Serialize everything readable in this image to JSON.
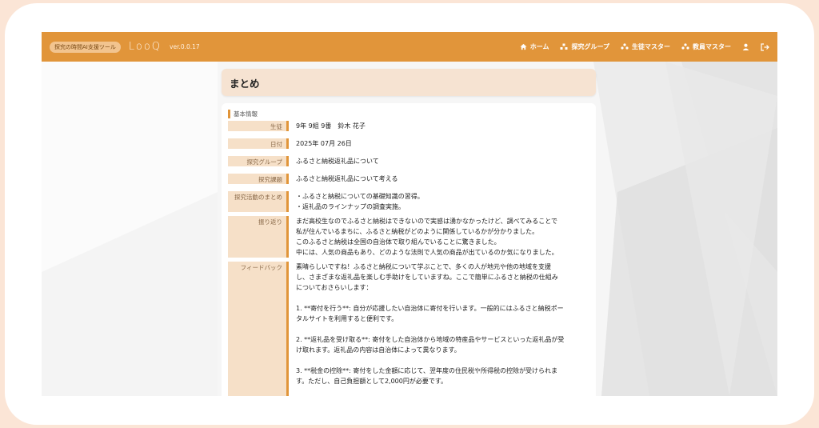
{
  "header": {
    "badge": "探究の時間AI支援ツール",
    "brand": "LooQ",
    "version": "ver.0.0.17",
    "nav": [
      {
        "label": "ホーム",
        "icon": "home-icon"
      },
      {
        "label": "探究グループ",
        "icon": "group-icon"
      },
      {
        "label": "生徒マスター",
        "icon": "students-icon"
      },
      {
        "label": "教員マスター",
        "icon": "teachers-icon"
      }
    ],
    "user_icon": "user-icon",
    "logout_icon": "logout-icon"
  },
  "page": {
    "title": "まとめ",
    "section": "基本情報",
    "fields": [
      {
        "label": "生徒",
        "value": "9年 9組 9番　鈴木 花子"
      },
      {
        "label": "日付",
        "value": "2025年 07月 26日"
      },
      {
        "label": "探究グループ",
        "value": "ふるさと納税返礼品について"
      },
      {
        "label": "探究課題",
        "value": "ふるさと納税返礼品について考える"
      },
      {
        "label": "探究活動のまとめ",
        "lines": [
          "・ふるさと納税についての基礎知識の習得。",
          "・返礼品のラインナップの調査実施。"
        ]
      },
      {
        "label": "振り返り",
        "lines": [
          "まだ高校生なのでふるさと納税はできないので実感は湧かなかったけど、調べてみることで",
          "私が住んでいるまちに、ふるさと納税がどのように関係しているかが分かりました。",
          "このふるさと納税は全国の自治体で取り組んでいることに驚きました。",
          "中には、人気の商品もあり、どのような法則で人気の商品が出ているのか気になりました。"
        ]
      },
      {
        "label": "フィードバック",
        "lines": [
          "素晴らしいですね！ふるさと納税について学ぶことで、多くの人が地元や他の地域を支援",
          "し、さまざまな返礼品を楽しむ手助けをしていますね。ここで簡単にふるさと納税の仕組み",
          "についておさらいします：",
          "",
          "1. **寄付を行う**: 自分が応援したい自治体に寄付を行います。一般的にはふるさと納税ポー",
          "タルサイトを利用すると便利です。",
          "",
          "2. **返礼品を受け取る**: 寄付をした自治体から地域の特産品やサービスといった返礼品が受",
          "け取れます。返礼品の内容は自治体によって異なります。",
          "",
          "3. **税金の控除**: 寄付をした金額に応じて、翌年度の住民税や所得税の控除が受けられま",
          "す。ただし、自己負担額として2,000円が必要です。"
        ]
      }
    ]
  },
  "colors": {
    "accent": "#e1953a",
    "label_bg": "#f6e0c8",
    "title_bg": "#f6e3d2",
    "outer_bg": "#fbe5d6"
  }
}
